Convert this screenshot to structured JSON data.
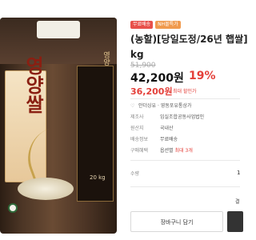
{
  "badges": [
    "무료배송",
    "NH몰특가"
  ],
  "product": {
    "title": "(농할)[당일도정/26년 햅쌀]",
    "title_line2": "kg",
    "original_price": "51,900",
    "price": "42,200원",
    "discount_rate": "19%",
    "coupon_price": "36,200원",
    "coupon_label": "최대 할인가"
  },
  "bag": {
    "title": "영양쌀",
    "subtitle": "영양",
    "weight": "20 kg"
  },
  "details": [
    {
      "label": "",
      "value": "안더싱유 · 영동포유통상가"
    },
    {
      "label": "제조사",
      "value": "임실조합공동사업법인"
    },
    {
      "label": "원산지",
      "value": "국내산"
    },
    {
      "label": "배송정보",
      "value": "무료배송"
    },
    {
      "label": "구매혜택",
      "value": "옵션별",
      "limit": "최대 3개"
    }
  ],
  "quantity": {
    "label": "수량",
    "value": "1"
  },
  "right_mark": "결",
  "buttons": {
    "cart": "장바구니 담기"
  },
  "colors": {
    "accent_red": "#e4403a",
    "badge_red": "#e8504a",
    "badge_orange": "#f09a4e"
  }
}
